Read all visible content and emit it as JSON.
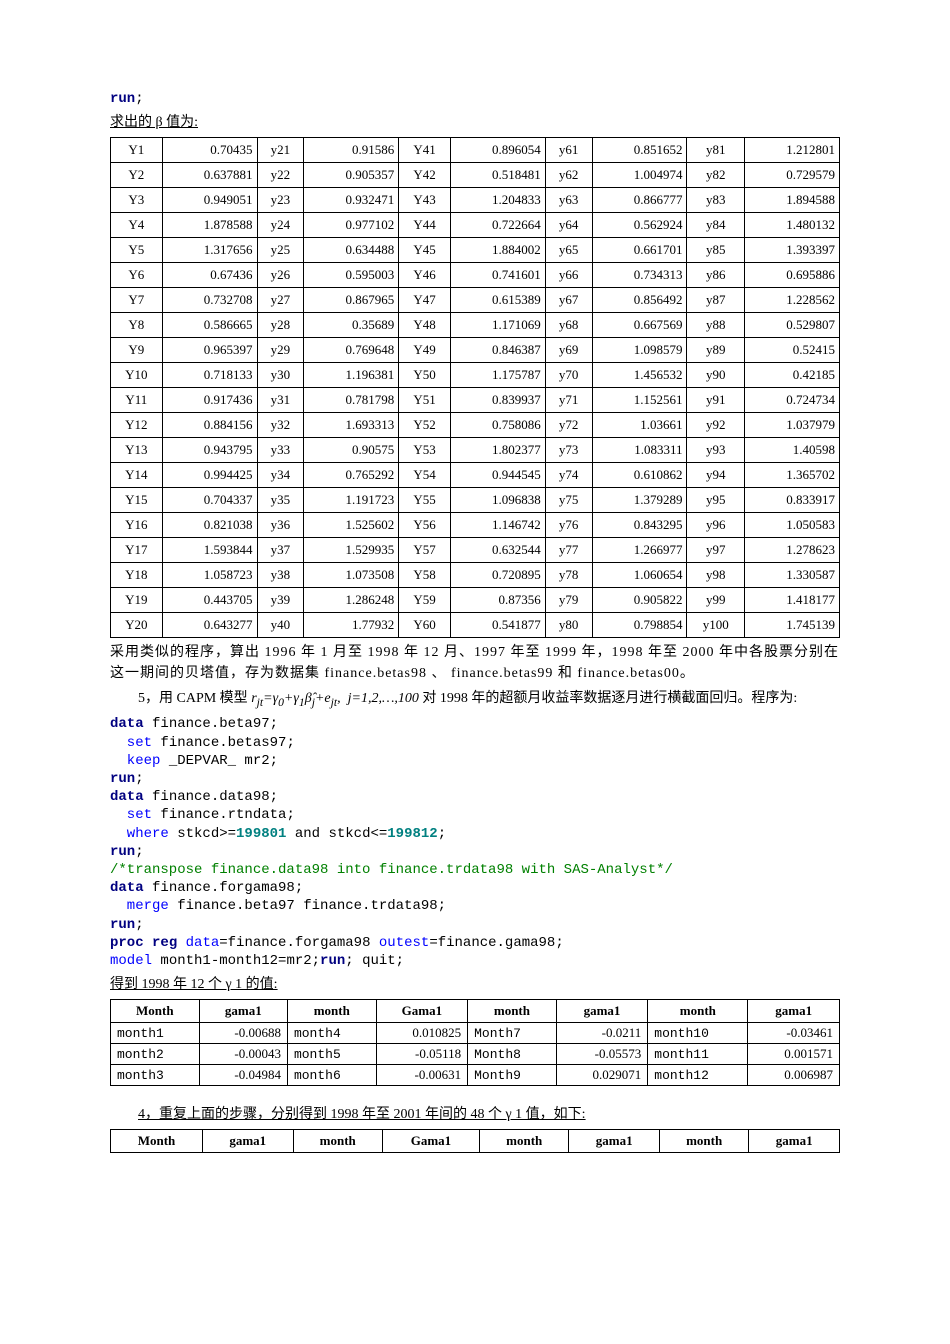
{
  "top_code": {
    "run": "run",
    "semicolon": ";"
  },
  "beta_heading": "求出的 β 值为:",
  "beta_table": [
    [
      "Y1",
      "0.70435",
      "y21",
      "0.91586",
      "Y41",
      "0.896054",
      "y61",
      "0.851652",
      "y81",
      "1.212801"
    ],
    [
      "Y2",
      "0.637881",
      "y22",
      "0.905357",
      "Y42",
      "0.518481",
      "y62",
      "1.004974",
      "y82",
      "0.729579"
    ],
    [
      "Y3",
      "0.949051",
      "y23",
      "0.932471",
      "Y43",
      "1.204833",
      "y63",
      "0.866777",
      "y83",
      "1.894588"
    ],
    [
      "Y4",
      "1.878588",
      "y24",
      "0.977102",
      "Y44",
      "0.722664",
      "y64",
      "0.562924",
      "y84",
      "1.480132"
    ],
    [
      "Y5",
      "1.317656",
      "y25",
      "0.634488",
      "Y45",
      "1.884002",
      "y65",
      "0.661701",
      "y85",
      "1.393397"
    ],
    [
      "Y6",
      "0.67436",
      "y26",
      "0.595003",
      "Y46",
      "0.741601",
      "y66",
      "0.734313",
      "y86",
      "0.695886"
    ],
    [
      "Y7",
      "0.732708",
      "y27",
      "0.867965",
      "Y47",
      "0.615389",
      "y67",
      "0.856492",
      "y87",
      "1.228562"
    ],
    [
      "Y8",
      "0.586665",
      "y28",
      "0.35689",
      "Y48",
      "1.171069",
      "y68",
      "0.667569",
      "y88",
      "0.529807"
    ],
    [
      "Y9",
      "0.965397",
      "y29",
      "0.769648",
      "Y49",
      "0.846387",
      "y69",
      "1.098579",
      "y89",
      "0.52415"
    ],
    [
      "Y10",
      "0.718133",
      "y30",
      "1.196381",
      "Y50",
      "1.175787",
      "y70",
      "1.456532",
      "y90",
      "0.42185"
    ],
    [
      "Y11",
      "0.917436",
      "y31",
      "0.781798",
      "Y51",
      "0.839937",
      "y71",
      "1.152561",
      "y91",
      "0.724734"
    ],
    [
      "Y12",
      "0.884156",
      "y32",
      "1.693313",
      "Y52",
      "0.758086",
      "y72",
      "1.03661",
      "y92",
      "1.037979"
    ],
    [
      "Y13",
      "0.943795",
      "y33",
      "0.90575",
      "Y53",
      "1.802377",
      "y73",
      "1.083311",
      "y93",
      "1.40598"
    ],
    [
      "Y14",
      "0.994425",
      "y34",
      "0.765292",
      "Y54",
      "0.944545",
      "y74",
      "0.610862",
      "y94",
      "1.365702"
    ],
    [
      "Y15",
      "0.704337",
      "y35",
      "1.191723",
      "Y55",
      "1.096838",
      "y75",
      "1.379289",
      "y95",
      "0.833917"
    ],
    [
      "Y16",
      "0.821038",
      "y36",
      "1.525602",
      "Y56",
      "1.146742",
      "y76",
      "0.843295",
      "y96",
      "1.050583"
    ],
    [
      "Y17",
      "1.593844",
      "y37",
      "1.529935",
      "Y57",
      "0.632544",
      "y77",
      "1.266977",
      "y97",
      "1.278623"
    ],
    [
      "Y18",
      "1.058723",
      "y38",
      "1.073508",
      "Y58",
      "0.720895",
      "y78",
      "1.060654",
      "y98",
      "1.330587"
    ],
    [
      "Y19",
      "0.443705",
      "y39",
      "1.286248",
      "Y59",
      "0.87356",
      "y79",
      "0.905822",
      "y99",
      "1.418177"
    ],
    [
      "Y20",
      "0.643277",
      "y40",
      "1.77932",
      "Y60",
      "0.541877",
      "y80",
      "0.798854",
      "y100",
      "1.745139"
    ]
  ],
  "para1": "采用类似的程序，算出 1996 年 1 月至 1998 年 12 月、1997 年至 1999 年，1998 年至 2000 年中各股票分别在这一期间的贝塔值，存为数据集 finance.betas98 、 finance.betas99 和 finance.betas00。",
  "item5_prefix": "5，用 CAPM 模型",
  "item5_formula": "r_{jt}=γ_0+γ_1 β̂_j+e_{jt},  j=1,2,…,100",
  "item5_suffix": "对 1998 年的超额月收益率数据逐月进行横截面回归。程序为:",
  "code2": {
    "l1_data": "data",
    "l1_rest": " finance.beta97;",
    "l2_set": "  set",
    "l2_rest": " finance.betas97;",
    "l3_keep": "  keep",
    "l3_rest": " _DEPVAR_ mr2;",
    "l4_run": "run",
    "l4_semi": ";",
    "l5_data": "data",
    "l5_rest": " finance.data98;",
    "l6_set": "  set",
    "l6_rest": " finance.rtndata;",
    "l7_where": "  where",
    "l7_rest1": " stkcd>=",
    "l7_num1": "199801",
    "l7_and": " and stkcd<=",
    "l7_num2": "199812",
    "l7_semi": ";",
    "l8_run": "run",
    "l8_semi": ";",
    "l9_comment": "/*transpose finance.data98 into finance.trdata98 with SAS-Analyst*/",
    "l10_data": "data",
    "l10_rest": " finance.forgama98;",
    "l11_merge": "  merge",
    "l11_rest": " finance.beta97 finance.trdata98;",
    "l12_run": "run",
    "l12_semi": ";",
    "l13_proc": "proc ",
    "l13_reg": "reg",
    "l13_data": " data",
    "l13_rest1": "=finance.forgama98 ",
    "l13_outest": "outest",
    "l13_rest2": "=finance.gama98;",
    "l14_model": "model",
    "l14_rest": " month1-month12=mr2;",
    "l14_run": "run",
    "l14_semi": "; quit;"
  },
  "gama_heading": "得到 1998 年 12 个 γ 1 的值:",
  "gama_headers": [
    "Month",
    "gama1",
    "month",
    "Gama1",
    "month",
    "gama1",
    "month",
    "gama1"
  ],
  "gama_rows": [
    [
      "month1",
      "-0.00688",
      "month4",
      "0.010825",
      "Month7",
      "-0.0211",
      "month10",
      "-0.03461"
    ],
    [
      "month2",
      "-0.00043",
      "month5",
      "-0.05118",
      "Month8",
      "-0.05573",
      "month11",
      "0.001571"
    ],
    [
      "month3",
      "-0.04984",
      "month6",
      "-0.00631",
      "Month9",
      "0.029071",
      "month12",
      "0.006987"
    ]
  ],
  "item4_text": "4，重复上面的步骤，分别得到 1998 年至 2001 年间的 48 个 γ 1 值，如下:",
  "gama48_headers": [
    "Month",
    "gama1",
    "month",
    "Gama1",
    "month",
    "gama1",
    "month",
    "gama1"
  ]
}
